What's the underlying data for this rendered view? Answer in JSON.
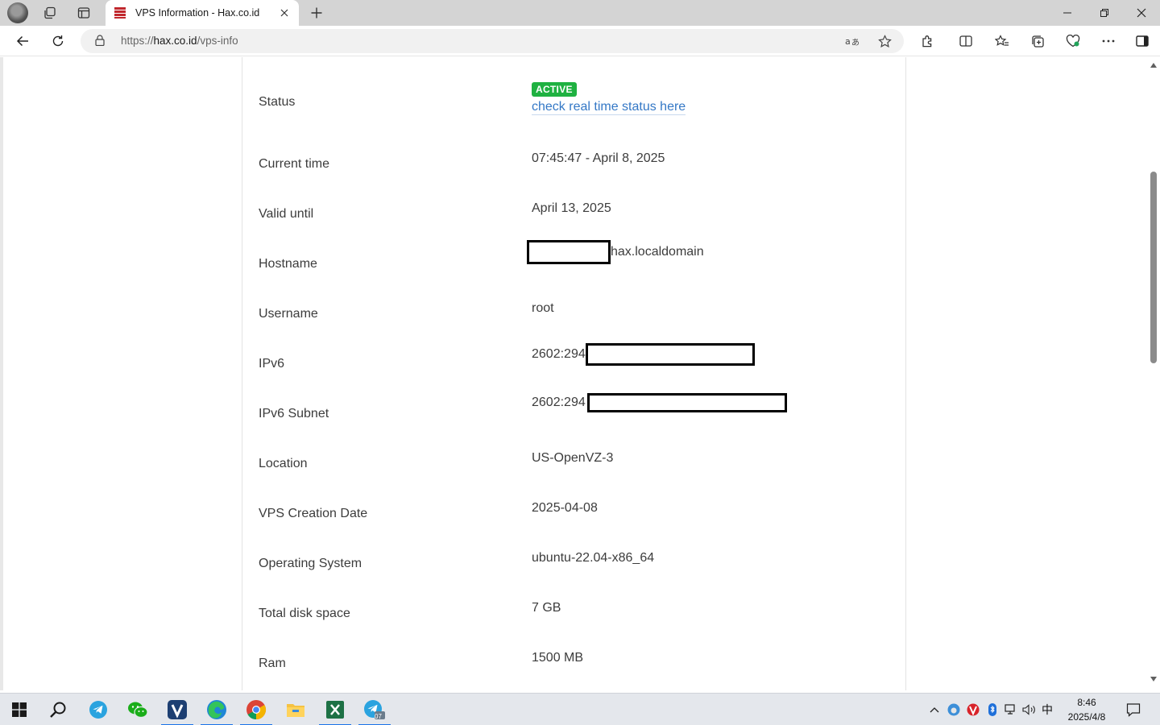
{
  "browser": {
    "tab_title": "VPS Information - Hax.co.id",
    "url_prefix": "https://",
    "url_host": "hax.co.id",
    "url_path": "/vps-info"
  },
  "page": {
    "status": {
      "label": "Status",
      "badge": "ACTIVE",
      "link": "check real time status here",
      "badge_color": "#1fb141",
      "link_color": "#3478c6"
    },
    "rows": [
      {
        "label": "Current time",
        "value": "07:45:47 - April 8, 2025"
      },
      {
        "label": "Valid until",
        "value": "April 13, 2025"
      },
      {
        "label": "Hostname",
        "value": "hax.localdomain"
      },
      {
        "label": "Username",
        "value": "root"
      },
      {
        "label": "IPv6",
        "value": "2602:294"
      },
      {
        "label": "IPv6 Subnet",
        "value": "2602:294"
      },
      {
        "label": "Location",
        "value": "US-OpenVZ-3"
      },
      {
        "label": "VPS Creation Date",
        "value": "2025-04-08"
      },
      {
        "label": "Operating System",
        "value": "ubuntu-22.04-x86_64"
      },
      {
        "label": "Total disk space",
        "value": "7 GB"
      },
      {
        "label": "Ram",
        "value": "1500 MB"
      }
    ]
  },
  "taskbar": {
    "time": "8:46",
    "date": "2025/4/8",
    "ime": "中",
    "telegram_badge": "07"
  }
}
